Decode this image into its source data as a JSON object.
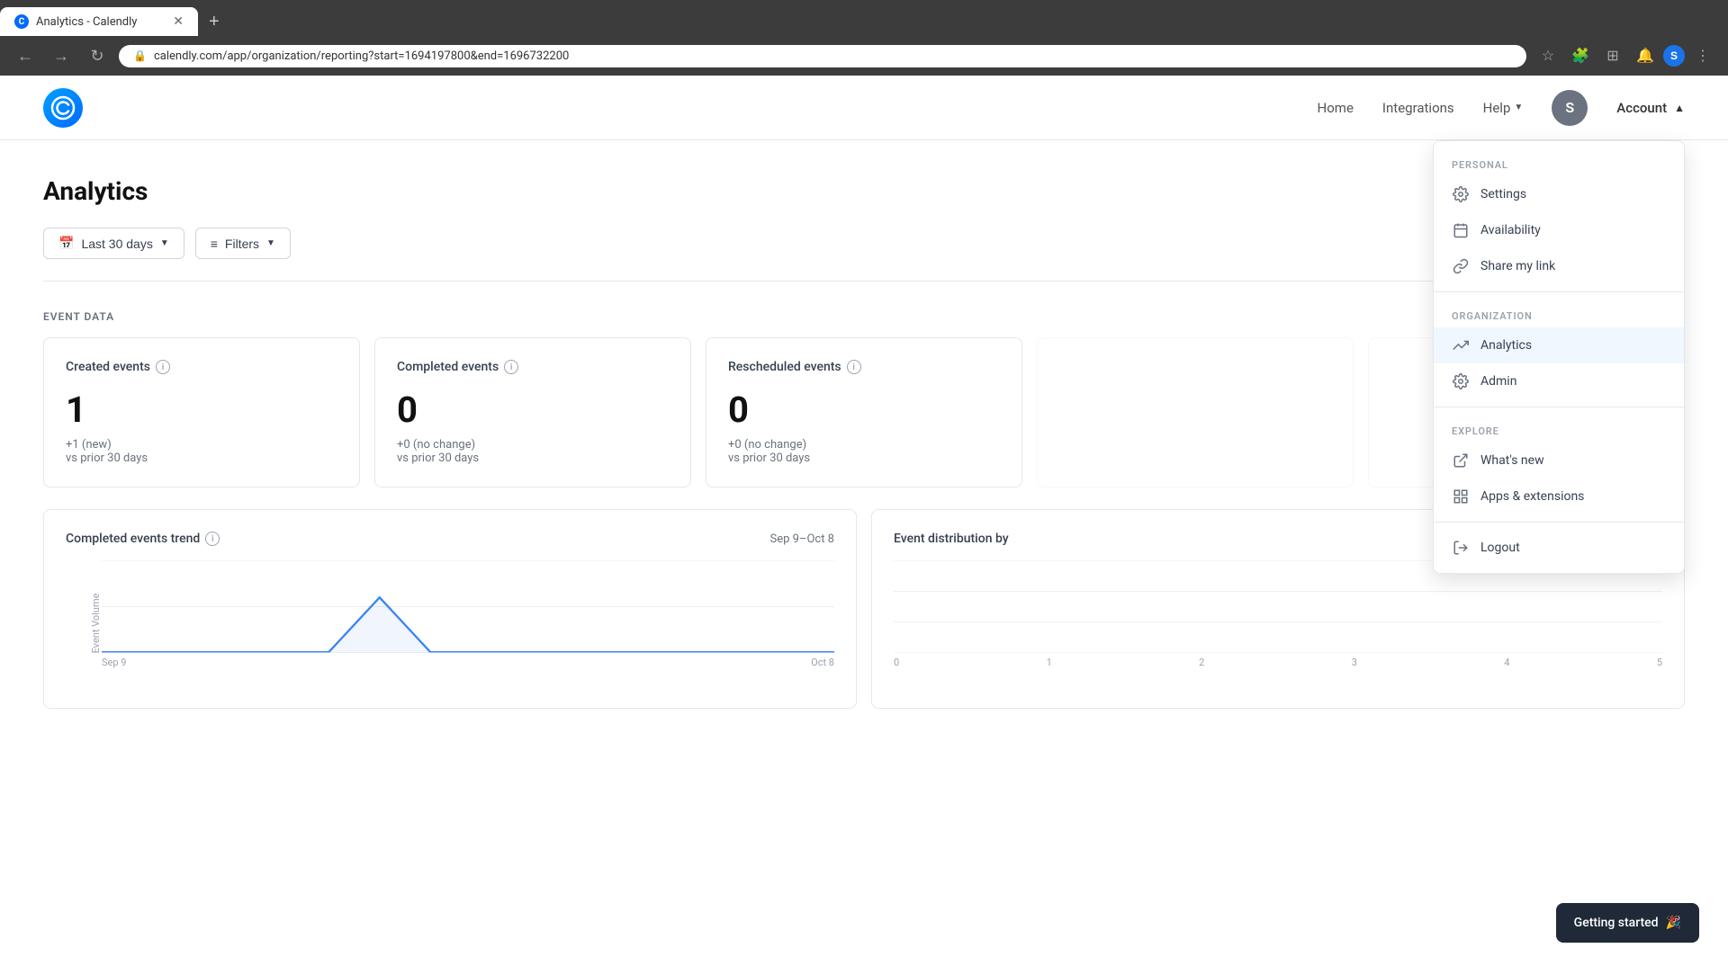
{
  "browser": {
    "tab_title": "Analytics - Calendly",
    "tab_favicon": "C",
    "url": "calendly.com/app/organization/reporting?start=1694197800&end=1696732200",
    "new_tab_label": "+"
  },
  "header": {
    "logo_alt": "Calendly",
    "nav": {
      "home": "Home",
      "integrations": "Integrations",
      "help": "Help",
      "account": "Account"
    },
    "avatar_letter": "S"
  },
  "page": {
    "title": "Analytics"
  },
  "filters": {
    "date_range": "Last 30 days",
    "filters_label": "Filters"
  },
  "event_data": {
    "section_label": "EVENT DATA",
    "cards": [
      {
        "title": "Created events",
        "value": "1",
        "change": "+1 (new)",
        "comparison": "vs prior 30 days"
      },
      {
        "title": "Completed events",
        "value": "0",
        "change": "+0 (no change)",
        "comparison": "vs prior 30 days"
      },
      {
        "title": "Rescheduled events",
        "value": "0",
        "change": "+0 (no change)",
        "comparison": "vs prior 30 days"
      }
    ]
  },
  "charts": {
    "trend_title": "Completed events trend",
    "trend_info": true,
    "trend_date": "Sep 9–Oct 8",
    "trend_y_label": "Event Volume",
    "trend_y_max": "1",
    "trend_y_min": "0",
    "distribution_title": "Event distribution by",
    "distribution_x_labels": [
      "0",
      "1",
      "2",
      "3",
      "4",
      "5"
    ]
  },
  "dropdown": {
    "personal_label": "PERSONAL",
    "settings": "Settings",
    "availability": "Availability",
    "share_my_link": "Share my link",
    "organization_label": "ORGANIZATION",
    "analytics": "Analytics",
    "admin": "Admin",
    "explore_label": "EXPLORE",
    "whats_new": "What's new",
    "apps_extensions": "Apps & extensions",
    "logout": "Logout"
  },
  "toast": {
    "label": "Getting started",
    "emoji": "🎉"
  },
  "colors": {
    "accent": "#0069ff",
    "active_bg": "#f0f7ff",
    "analytics_active": true
  }
}
